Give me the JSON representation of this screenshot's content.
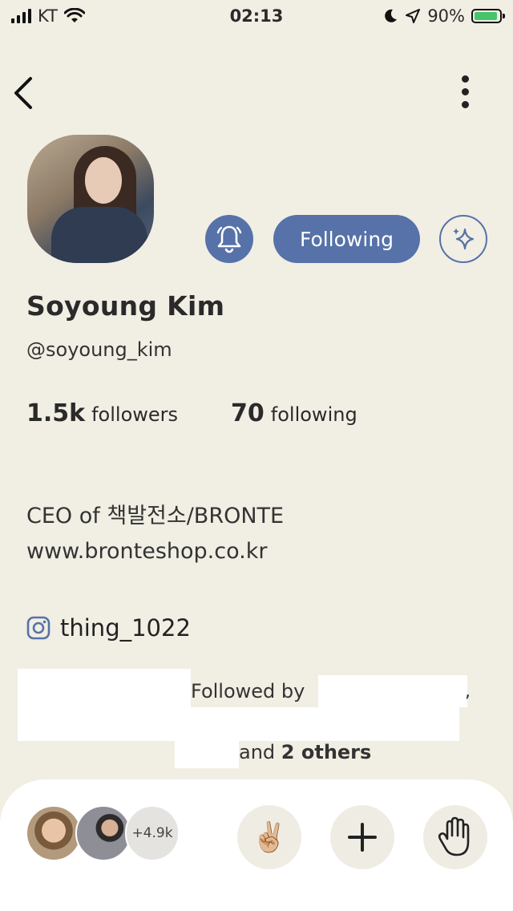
{
  "status_bar": {
    "carrier": "KT",
    "time": "02:13",
    "battery_percent": "90%",
    "icons": [
      "signal-icon",
      "wifi-icon",
      "moon-icon",
      "location-icon",
      "battery-charging-icon"
    ]
  },
  "nav": {
    "back_icon": "chevron-left-icon",
    "more_icon": "more-vertical-icon"
  },
  "profile": {
    "name": "Soyoung Kim",
    "handle": "@soyoung_kim",
    "followers_count": "1.5k",
    "followers_label": "followers",
    "following_count": "70",
    "following_label": "following",
    "bio_line1": "CEO of 책발전소/BRONTE",
    "bio_line2": "www.bronteshop.co.kr",
    "instagram": "thing_1022"
  },
  "actions": {
    "following_label": "Following",
    "bell_icon": "bell-icon",
    "spark_icon": "sparkle-icon"
  },
  "followed_by": {
    "prefix": "Followed by",
    "comma": ",",
    "and_text": "and",
    "others": "2 others"
  },
  "bottom_bar": {
    "more_count": "+4.9k",
    "peace_emoji": "✌🏼",
    "icons": [
      "peace-hand-icon",
      "plus-icon",
      "raise-hand-icon"
    ]
  },
  "colors": {
    "background": "#f1eee4",
    "accent": "#5672a8",
    "battery_green": "#46c46b"
  }
}
